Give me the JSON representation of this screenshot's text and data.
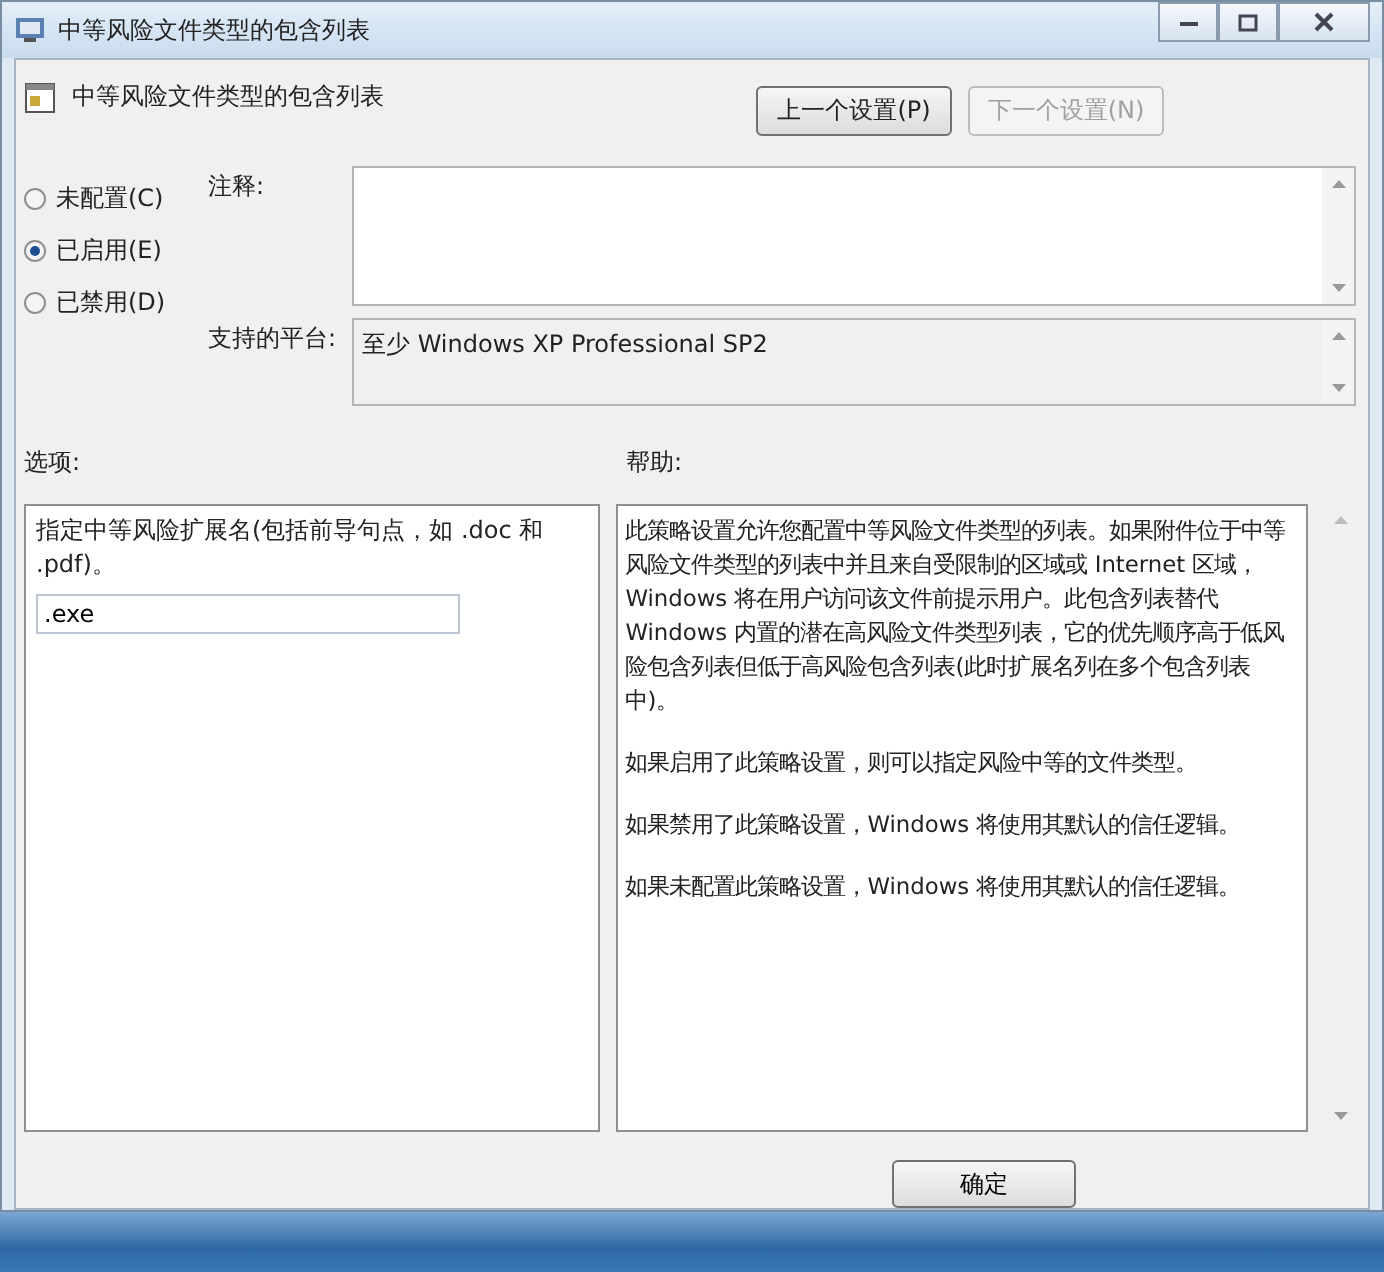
{
  "window": {
    "title": "中等风险文件类型的包含列表"
  },
  "header": {
    "title": "中等风险文件类型的包含列表",
    "buttons": [
      {
        "label": "上一个设置(P)",
        "disabled": false
      },
      {
        "label": "下一个设置(N)",
        "disabled": true
      }
    ]
  },
  "state_options": [
    {
      "label": "未配置(C)",
      "selected": false
    },
    {
      "label": "已启用(E)",
      "selected": true
    },
    {
      "label": "已禁用(D)",
      "selected": false
    }
  ],
  "comment": {
    "label": "注释:"
  },
  "platform": {
    "label": "支持的平台:",
    "value": "至少 Windows XP Professional SP2"
  },
  "options": {
    "label": "选项:",
    "description": "指定中等风险扩展名(包括前导句点，如  .doc 和 .pdf)。",
    "value": ".exe"
  },
  "help": {
    "label": "帮助:",
    "paragraphs": [
      "此策略设置允许您配置中等风险文件类型的列表。如果附件位于中等风险文件类型的列表中并且来自受限制的区域或 Internet 区域，Windows 将在用户访问该文件前提示用户。此包含列表替代 Windows 内置的潜在高风险文件类型列表，它的优先顺序高于低风险包含列表但低于高风险包含列表(此时扩展名列在多个包含列表中)。",
      "如果启用了此策略设置，则可以指定风险中等的文件类型。",
      "如果禁用了此策略设置，Windows 将使用其默认的信任逻辑。",
      "如果未配置此策略设置，Windows 将使用其默认的信任逻辑。"
    ]
  },
  "footer_buttons": [
    "确定"
  ]
}
